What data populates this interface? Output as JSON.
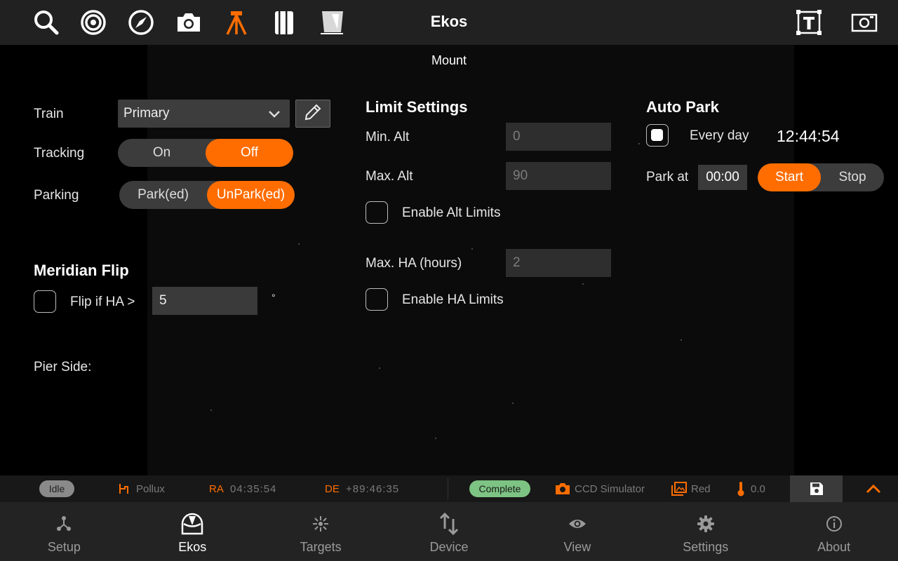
{
  "app": {
    "title": "Ekos"
  },
  "toolbar": {
    "icons": [
      "search-icon",
      "target-icon",
      "compass-icon",
      "camera-icon",
      "tripod-icon",
      "notebook-icon",
      "flat-panel-icon",
      "text-frame-icon",
      "screen-icon"
    ],
    "active_icon": "tripod-icon"
  },
  "module": {
    "title": "Mount"
  },
  "train": {
    "label": "Train",
    "value": "Primary"
  },
  "tracking": {
    "label": "Tracking",
    "on": "On",
    "off": "Off",
    "selected": "Off"
  },
  "parking": {
    "label": "Parking",
    "park": "Park(ed)",
    "unpark": "UnPark(ed)",
    "selected": "UnPark(ed)"
  },
  "meridian_flip": {
    "title": "Meridian Flip",
    "label": "Flip if HA >",
    "value": "5",
    "unit": "°",
    "checked": false
  },
  "pier_side": {
    "label": "Pier Side:"
  },
  "limits": {
    "title": "Limit Settings",
    "min_alt_label": "Min. Alt",
    "min_alt_value": "0",
    "max_alt_label": "Max. Alt",
    "max_alt_value": "90",
    "enable_alt_label": "Enable Alt Limits",
    "enable_alt_checked": false,
    "max_ha_label": "Max. HA (hours)",
    "max_ha_value": "2",
    "enable_ha_label": "Enable HA Limits",
    "enable_ha_checked": false
  },
  "auto_park": {
    "title": "Auto Park",
    "every_day_label": "Every day",
    "every_day_checked": true,
    "clock": "12:44:54",
    "park_at_label": "Park at",
    "park_at_value": "00:00",
    "start": "Start",
    "stop": "Stop",
    "selected": "Start"
  },
  "statusbar": {
    "mount_state": "Idle",
    "target": "Pollux",
    "ra_label": "RA",
    "ra_value": "04:35:54",
    "de_label": "DE",
    "de_value": "+89:46:35",
    "capture_state": "Complete",
    "camera": "CCD Simulator",
    "filter": "Red",
    "temperature": "0.0"
  },
  "colors": {
    "accent": "#ff6d00",
    "complete": "#7dc383",
    "idle": "#8a8a8a",
    "toolbar": "#212121",
    "nav": "#232323"
  },
  "bottom_nav": {
    "items": [
      {
        "label": "Setup",
        "icon": "setup-icon"
      },
      {
        "label": "Ekos",
        "icon": "observatory-icon"
      },
      {
        "label": "Targets",
        "icon": "targets-icon"
      },
      {
        "label": "Device",
        "icon": "device-icon"
      },
      {
        "label": "View",
        "icon": "eye-icon"
      },
      {
        "label": "Settings",
        "icon": "gear-icon"
      },
      {
        "label": "About",
        "icon": "info-icon"
      }
    ],
    "active": "Ekos"
  }
}
